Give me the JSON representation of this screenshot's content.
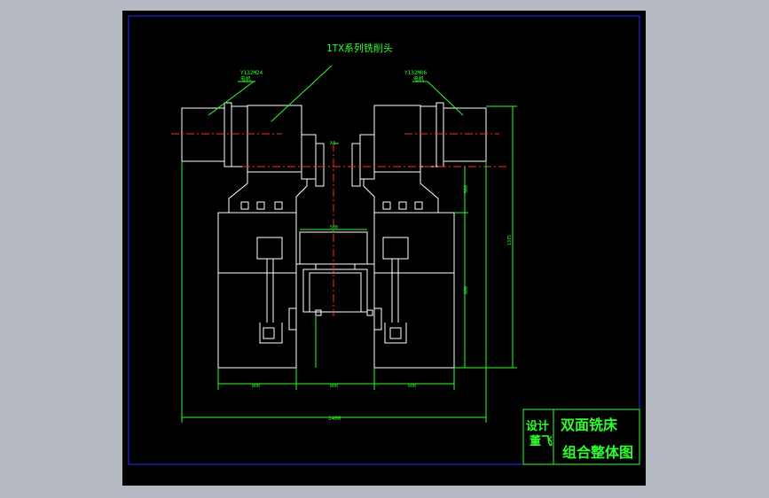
{
  "drawing": {
    "head_label": "1TX系列铣削头",
    "motor_left": {
      "model": "Y132M24",
      "note": "电机"
    },
    "motor_right": {
      "model": "Y132M06",
      "note": "电机"
    },
    "dim_top_left": "X4",
    "dim_mid": "500",
    "dim_right_upper": "500",
    "dim_right_lower": "800",
    "dim_right_total": "1375",
    "dim_bottom_left": "800",
    "dim_bottom_mid": "800",
    "dim_bottom_right": "600",
    "dim_overall": "3400"
  },
  "title_block": {
    "label_design": "设计",
    "designer": "董飞",
    "title_line1": "双面铣床",
    "title_line2": "组合整体图"
  },
  "colors": {
    "outline": "#ffffff",
    "dimension": "#2cff2c",
    "centerline": "#ff2a2a",
    "border": "#2a2aff",
    "background": "#000000"
  }
}
